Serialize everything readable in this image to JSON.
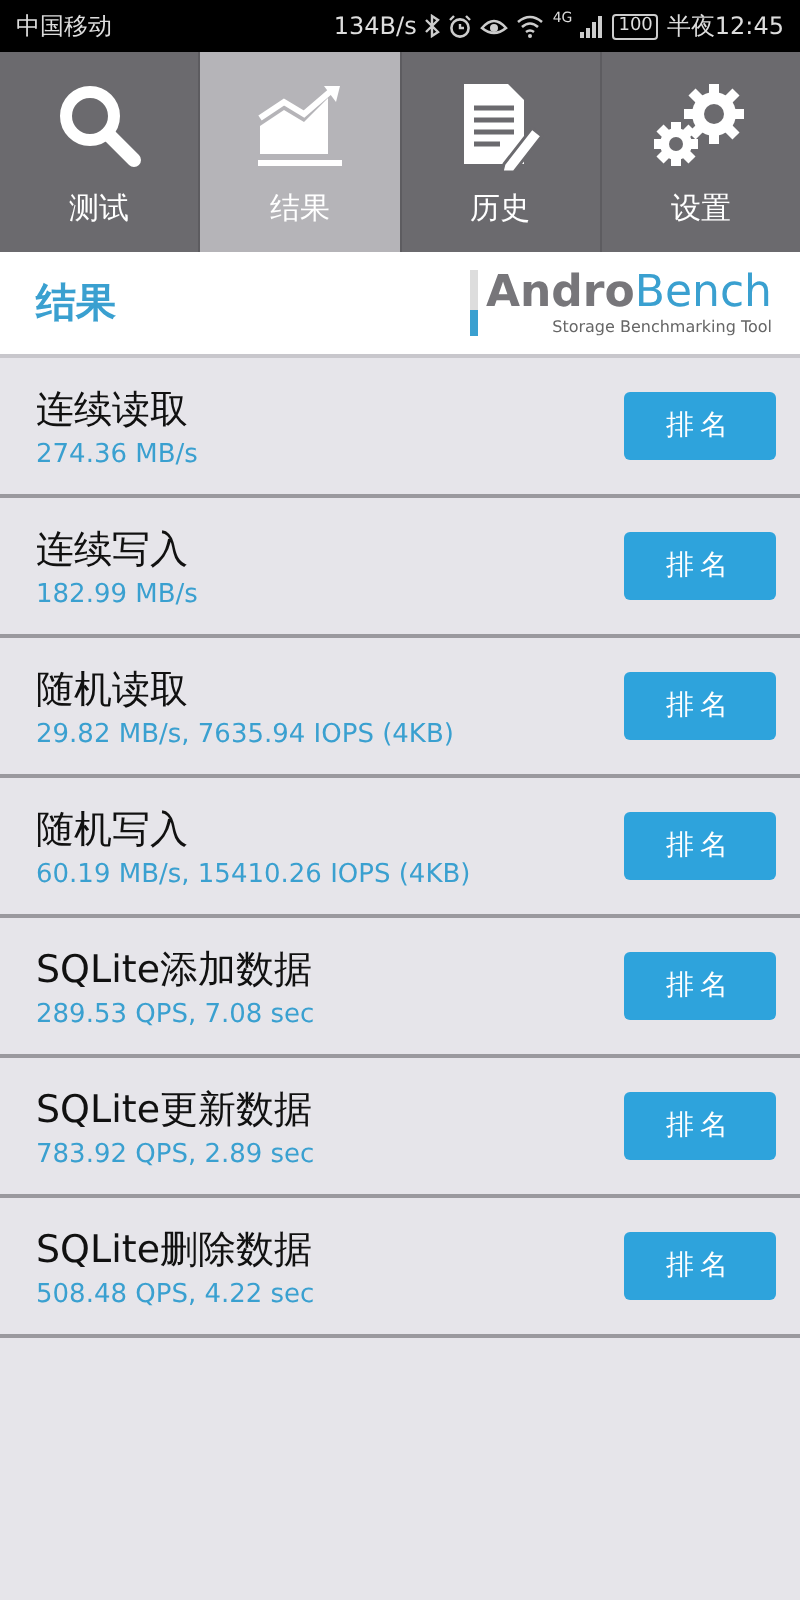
{
  "status_bar": {
    "carrier": "中国移动",
    "speed": "134B/s",
    "network": "4G",
    "battery": "100",
    "time": "半夜12:45"
  },
  "tabs": [
    {
      "label": "测试",
      "kind": "search",
      "selected": false
    },
    {
      "label": "结果",
      "kind": "chart",
      "selected": true
    },
    {
      "label": "历史",
      "kind": "document",
      "selected": false
    },
    {
      "label": "设置",
      "kind": "gears",
      "selected": false
    }
  ],
  "header": {
    "title": "结果",
    "logo": "**Andro**Bench",
    "logo_subtitle": "Storage Benchmarking Tool"
  },
  "results": [
    {
      "name": "连续读取",
      "value": "274.36 MB/s",
      "button": "排名"
    },
    {
      "name": "连续写入",
      "value": "182.99 MB/s",
      "button": "排名"
    },
    {
      "name": "随机读取",
      "value": "29.82 MB/s, 7635.94 IOPS (4KB)",
      "button": "排名"
    },
    {
      "name": "随机写入",
      "value": "60.19 MB/s, 15410.26 IOPS (4KB)",
      "button": "排名"
    },
    {
      "name": "SQLite添加数据",
      "value": "289.53 QPS, 7.08 sec",
      "button": "排名"
    },
    {
      "name": "SQLite更新数据",
      "value": "783.92 QPS, 2.89 sec",
      "button": "排名"
    },
    {
      "name": "SQLite删除数据",
      "value": "508.48 QPS, 4.22 sec",
      "button": "排名"
    }
  ]
}
